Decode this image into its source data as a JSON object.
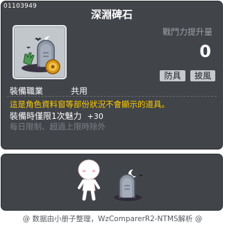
{
  "item": {
    "id": "01103949",
    "name": "深淵碑石",
    "icon": "tombstone-hand-coin-icon"
  },
  "power": {
    "label": "戰鬥力提升量",
    "value": "0"
  },
  "tags": {
    "armor": "防具",
    "cape": "披風"
  },
  "job": {
    "label": "裝備職業",
    "value": "共用"
  },
  "description": "這是角色資料窗等部份狀況不會顯示的道具。",
  "equip_limit": {
    "text": "裝備時僅限1次魅力",
    "bonus": "+30"
  },
  "daily_limit": "每日限制、超過上限時除外",
  "preview": {
    "character": "white-blob-character",
    "tombstone": "tombstone-with-moon-icon"
  },
  "footer": "@ 数据由小册子整理，WzComparerR2-NTMS解析 @",
  "colors": {
    "panel": "#414449",
    "accent": "#ffcc00",
    "muted": "#7c8087"
  }
}
